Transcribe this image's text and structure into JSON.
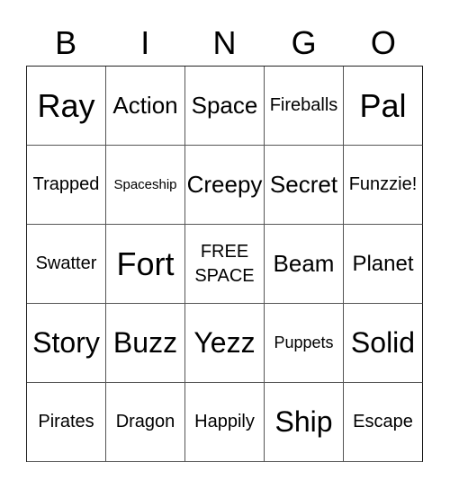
{
  "header": [
    "B",
    "I",
    "N",
    "G",
    "O"
  ],
  "rows": [
    [
      "Ray",
      "Action",
      "Space",
      "Fireballs",
      "Pal"
    ],
    [
      "Trapped",
      "Spaceship",
      "Creepy",
      "Secret",
      "Funzzie!"
    ],
    [
      "Swatter",
      "Fort",
      "FREE SPACE",
      "Beam",
      "Planet"
    ],
    [
      "Story",
      "Buzz",
      "Yezz",
      "Puppets",
      "Solid"
    ],
    [
      "Pirates",
      "Dragon",
      "Happily",
      "Ship",
      "Escape"
    ]
  ]
}
